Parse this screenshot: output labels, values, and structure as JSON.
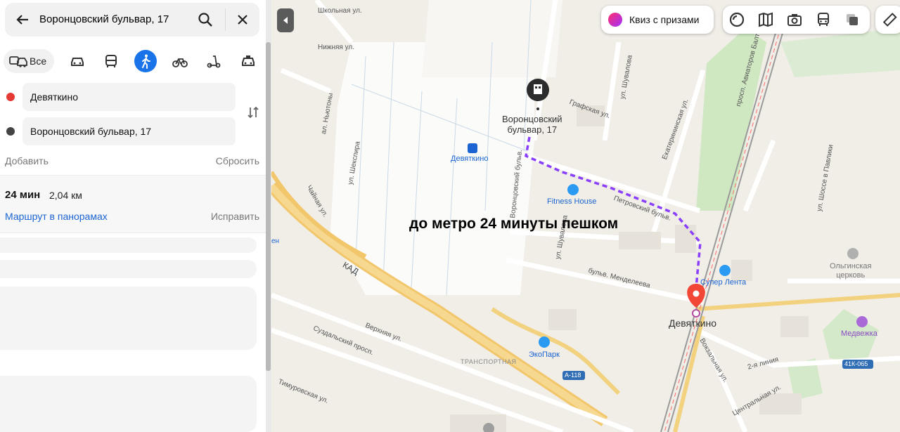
{
  "search": {
    "query": "Воронцовский бульвар, 17"
  },
  "modes": {
    "all_label": "Все",
    "active": "pedestrian"
  },
  "route_points": [
    {
      "label": "Девяткино",
      "color": "#e53935"
    },
    {
      "label": "Воронцовский бульвар, 17",
      "color": "#444444"
    }
  ],
  "actions": {
    "add": "Добавить",
    "reset": "Сбросить"
  },
  "route": {
    "time": "24 мин",
    "distance": "2,04 км",
    "panorama_link": "Маршрут в панорамах",
    "fix_link": "Исправить"
  },
  "map_controls": {
    "quiz_label": "Квиз с призами"
  },
  "map": {
    "destination_label": "Воронцовский\nбульвар, 17",
    "metro_label": "Девяткино",
    "metro_station_label": "Девяткино",
    "fitness_label": "Fitness House",
    "super_lenta_label": "Супер Лента",
    "ekopark_label": "ЭкоПарк",
    "church_label": "Ольгинская\nцерковь",
    "medvezhka_label": "Медвежка",
    "transport_label": "ТРАНСПОРТНАЯ",
    "kad_label": "КАД",
    "road_a118": "А-118",
    "road_41k": "41К-065",
    "partial_left": "ен",
    "overlay_caption": "до метро 24 минуты пешком",
    "streets": {
      "shkolnaya": "Школьная ул.",
      "nizhnyaya": "Нижняя ул.",
      "nyupty": "ал. Ньютоны",
      "shekspira": "ул. Шекспира",
      "chaynaya": "Чайная ул.",
      "vorontsovsky": "Воронцовский бульв.",
      "shuvalova": "ул. Шувалова",
      "grafskaya": "Графская ул.",
      "ekaterininskaya": "Екатерининская ул.",
      "petrovsky": "Петровский бульв.",
      "mendeleeva": "бульв. Менделеева",
      "shuvalova2": "ул. Шувалова",
      "verkhnyaya": "Верхняя ул.",
      "suzdalsky": "Суздальский просп.",
      "timurovskaya": "Тимуровская ул.",
      "aviatorov": "просп. Авиаторов Балтики",
      "shosse_pavliki": "ул. Шоссе в Павлики",
      "vokzalnaya": "Вокзальная ул.",
      "vtoraya_liniya": "2-я линия",
      "tsentralnaya": "Центральная ул."
    }
  },
  "colors": {
    "route_dash": "#8a3ffc",
    "pin_red": "#f24637",
    "active_mode": "#1a73e8",
    "link_blue": "#1b64d2"
  }
}
